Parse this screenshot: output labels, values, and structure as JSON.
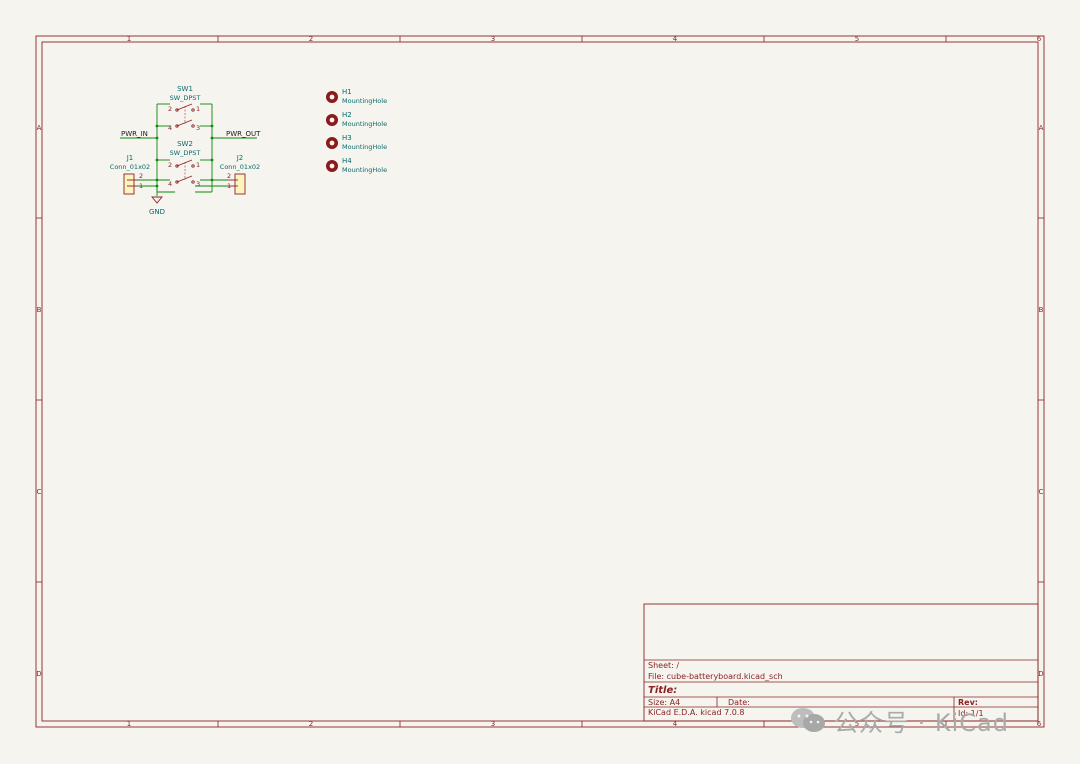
{
  "zones": {
    "columns": [
      "1",
      "2",
      "3",
      "4",
      "5",
      "6"
    ],
    "rows": [
      "A",
      "B",
      "C",
      "D"
    ]
  },
  "title_block": {
    "sheet": "Sheet: /",
    "file": "File: cube-batteryboard.kicad_sch",
    "title": "Title:",
    "size": "Size: A4",
    "date": "Date:",
    "rev": "Rev:",
    "tool": "KiCad E.D.A.  kicad 7.0.8",
    "id": "Id: 1/1"
  },
  "schematic": {
    "sw1": {
      "ref": "SW1",
      "value": "SW_DPST",
      "pins": [
        "2",
        "1",
        "4",
        "3"
      ]
    },
    "sw2": {
      "ref": "SW2",
      "value": "SW_DPST",
      "pins": [
        "2",
        "1",
        "4",
        "3"
      ]
    },
    "j1": {
      "ref": "J1",
      "value": "Conn_01x02",
      "pins": [
        "2",
        "1"
      ]
    },
    "j2": {
      "ref": "J2",
      "value": "Conn_01x02",
      "pins": [
        "2",
        "1"
      ]
    },
    "labels": {
      "pwr_in": "PWR_IN",
      "pwr_out": "PWR_OUT",
      "gnd": "GND"
    },
    "holes": [
      {
        "ref": "H1",
        "value": "MountingHole"
      },
      {
        "ref": "H2",
        "value": "MountingHole"
      },
      {
        "ref": "H3",
        "value": "MountingHole"
      },
      {
        "ref": "H4",
        "value": "MountingHole"
      }
    ]
  },
  "watermark": {
    "text": "公众号 · KiCad",
    "icon": "wechat-icon"
  },
  "colors": {
    "frame": "#8b2323",
    "wire": "#0b8a0b",
    "background": "#f5f4ef"
  }
}
